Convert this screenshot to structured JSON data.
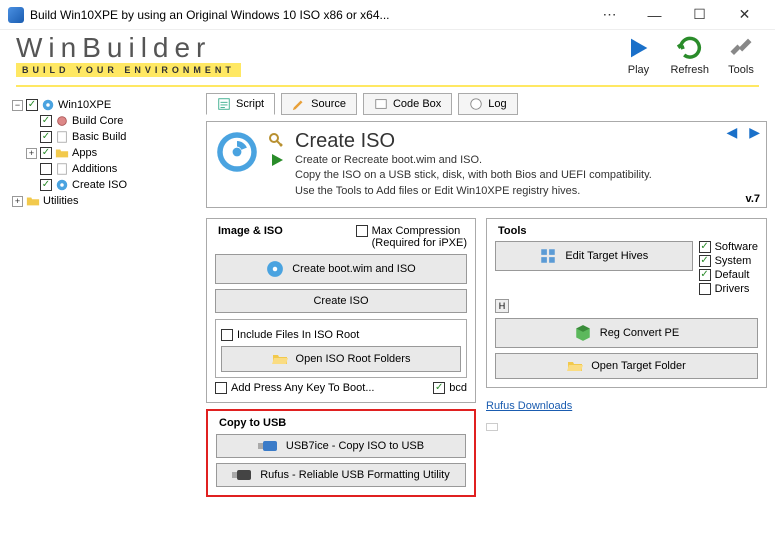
{
  "window": {
    "title": "Build Win10XPE by using an Original Windows 10 ISO x86 or x64..."
  },
  "logo": {
    "main": "WinBuilder",
    "sub": "BUILD YOUR ENVIRONMENT"
  },
  "header_tools": {
    "play": "Play",
    "refresh": "Refresh",
    "tools": "Tools"
  },
  "tabs": {
    "script": "Script",
    "source": "Source",
    "codebox": "Code Box",
    "log": "Log"
  },
  "tree": {
    "root": "Win10XPE",
    "items": [
      {
        "label": "Build Core",
        "checked": true
      },
      {
        "label": "Basic Build",
        "checked": true
      },
      {
        "label": "Apps",
        "checked": true,
        "expandable": true
      },
      {
        "label": "Additions",
        "checked": false
      },
      {
        "label": "Create ISO",
        "checked": true
      }
    ],
    "utilities": "Utilities"
  },
  "hero": {
    "title": "Create ISO",
    "line1": "Create or Recreate boot.wim and ISO.",
    "line2": "Copy the ISO on a USB stick, disk, with both Bios and UEFI compatibility.",
    "line3": "Use the Tools to Add files or Edit Win10XPE registry hives.",
    "version": "v.7"
  },
  "image_iso": {
    "title": "Image & ISO",
    "max_compression": "Max Compression",
    "max_compression_sub": "(Required for iPXE)",
    "btn_boot": "Create boot.wim and ISO",
    "btn_iso": "Create ISO",
    "include_root": "Include Files In ISO Root",
    "btn_open_root": "Open ISO Root Folders",
    "press_key": "Add Press Any Key To Boot...",
    "bcd": "bcd"
  },
  "copy_usb": {
    "title": "Copy to USB",
    "btn1": "USB7ice - Copy ISO to USB",
    "btn2": "Rufus - Reliable USB Formatting Utility"
  },
  "tools": {
    "title": "Tools",
    "btn_edit": "Edit Target Hives",
    "chk_software": "Software",
    "chk_system": "System",
    "chk_default": "Default",
    "chk_drivers": "Drivers",
    "btn_reg": "Reg Convert PE",
    "btn_open": "Open Target Folder",
    "h": "H"
  },
  "link": {
    "rufus": "Rufus Downloads"
  }
}
